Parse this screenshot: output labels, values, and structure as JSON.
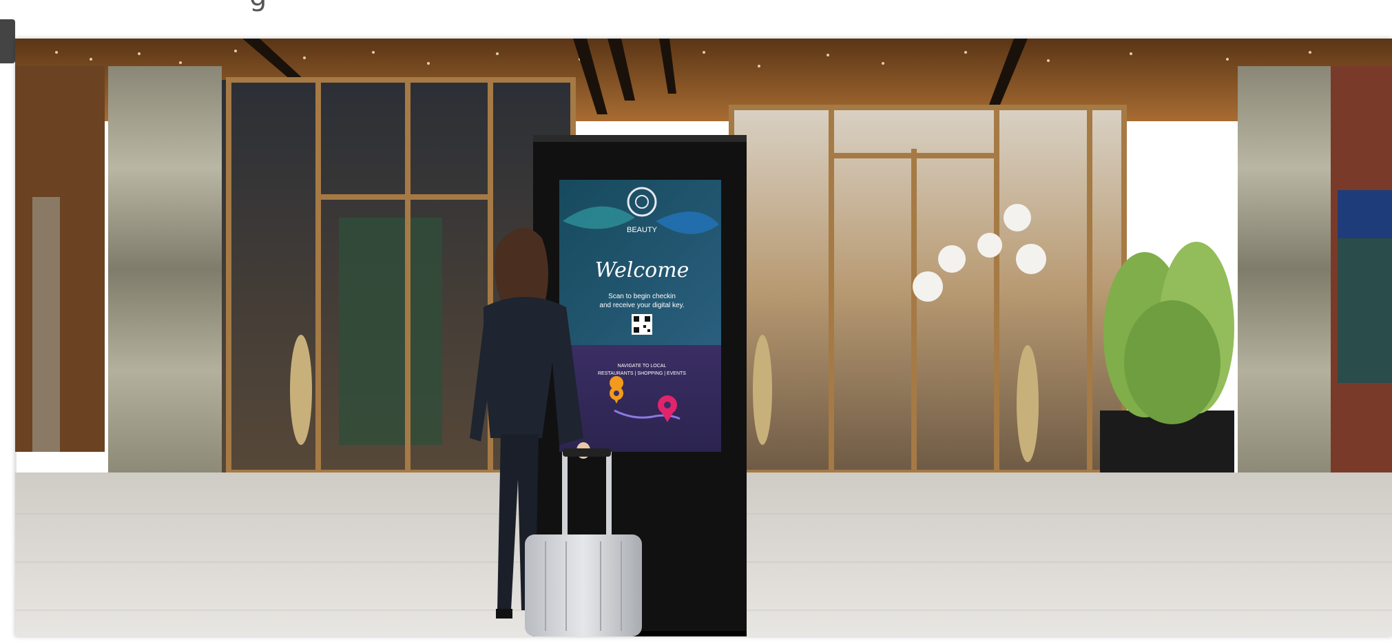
{
  "photo": {
    "subject": "hotel-lobby-entrance-with-digital-kiosk",
    "kiosk": {
      "brand": "BEAUTY",
      "headline": "Welcome",
      "line1": "Scan to begin checkin",
      "line2": "and receive your digital key.",
      "nav_line1": "NAVIGATE TO LOCAL",
      "nav_line2": "RESTAURANTS | SHOPPING | EVENTS"
    },
    "colors": {
      "ceiling": "#8a5a2a",
      "floor": "#d9d7d2",
      "kiosk_body": "#111111",
      "screen_top": "#1d4d63",
      "screen_bottom": "#3a3060",
      "pin_orange": "#f29a1b",
      "pin_pink": "#e2246d"
    }
  }
}
